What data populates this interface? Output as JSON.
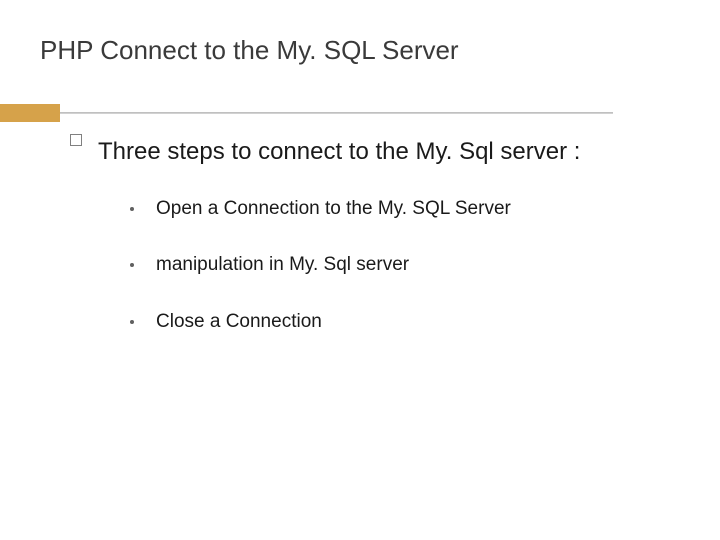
{
  "slide": {
    "title": "PHP Connect to the My. SQL Server",
    "mainBullet": "Three  steps to connect to the My. Sql server :",
    "subBullets": [
      "Open a Connection to the My. SQL Server",
      "manipulation in My. Sql server",
      "Close a Connection"
    ]
  }
}
